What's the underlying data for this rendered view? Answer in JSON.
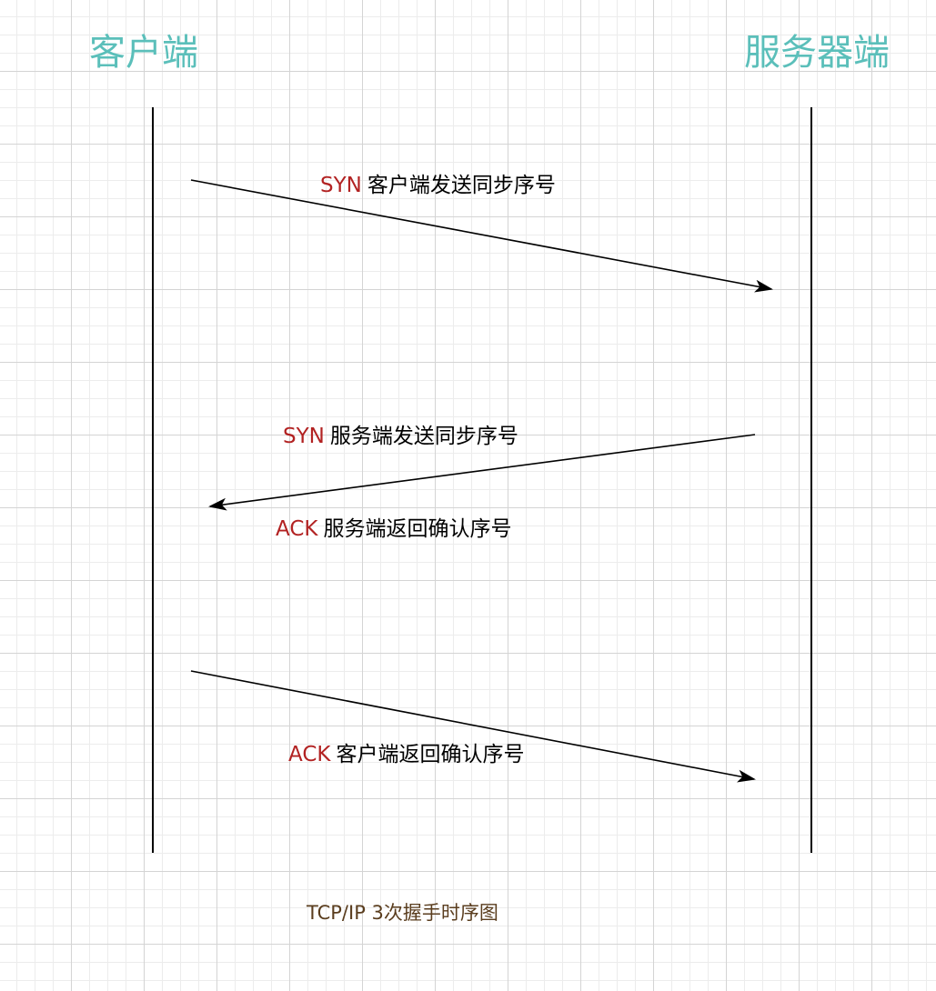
{
  "colors": {
    "title": "#5bbfba",
    "keyword": "#b22222",
    "text": "#000000",
    "caption": "#5a3d1e",
    "line": "#000000"
  },
  "lifelines": {
    "client": "客户端",
    "server": "服务器端"
  },
  "messages": [
    {
      "keyword": "SYN",
      "text": "客户端发送同步序号",
      "direction": "client-to-server"
    },
    {
      "keyword": "SYN",
      "text": "服务端发送同步序号",
      "direction": "server-to-client"
    },
    {
      "keyword": "ACK",
      "text": "服务端返回确认序号",
      "direction": "server-to-client"
    },
    {
      "keyword": "ACK",
      "text": "客户端返回确认序号",
      "direction": "client-to-server"
    }
  ],
  "caption": "TCP/IP 3次握手时序图"
}
